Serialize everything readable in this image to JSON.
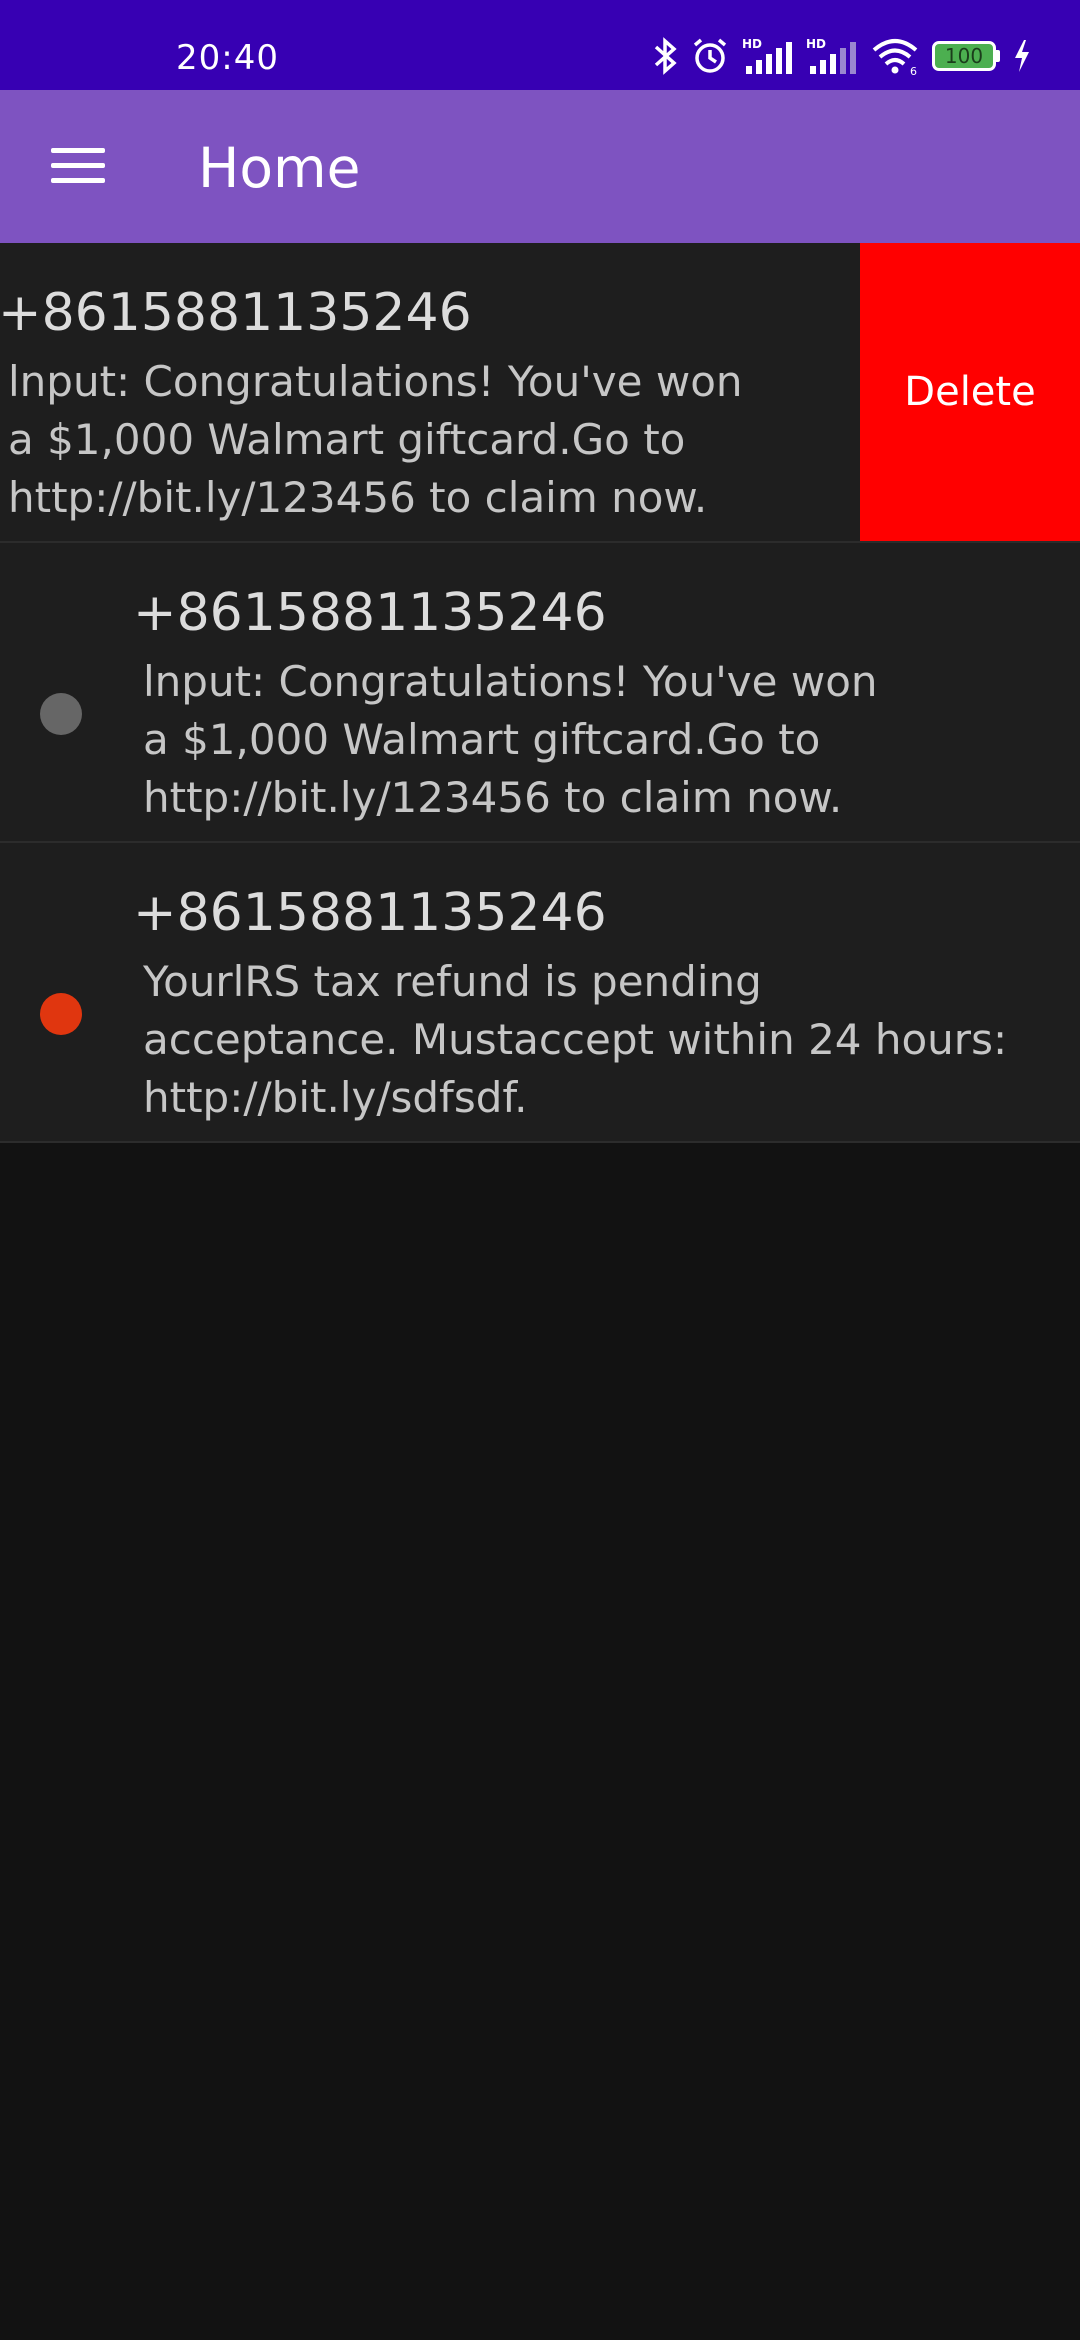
{
  "status_bar": {
    "time": "20:40",
    "battery_level": "100",
    "icons": [
      "bluetooth-icon",
      "alarm-icon",
      "signal-hd-icon",
      "signal-hd-icon",
      "wifi-icon",
      "battery-icon",
      "charging-icon"
    ]
  },
  "app_bar": {
    "title": "Home",
    "menu_icon": "hamburger-menu-icon",
    "background_color": "#7e53c1"
  },
  "messages": [
    {
      "sender": "+8615881135246",
      "preview": "lnput: Congratulations! You've won\na $1,000 Walmart giftcard.Go to\nhttp://bit.ly/123456 to claim now.",
      "status_color": "#666666",
      "swiped": true,
      "delete_label": "Delete"
    },
    {
      "sender": "+8615881135246",
      "preview": "lnput: Congratulations! You've won\na $1,000 Walmart giftcard.Go to\nhttp://bit.ly/123456 to claim now.",
      "status_color": "#666666",
      "swiped": false
    },
    {
      "sender": "+8615881135246",
      "preview": " YourlRS tax refund is pending\nacceptance. Mustaccept within 24 hours:\nhttp://bit.ly/sdfsdf.",
      "status_color": "#e0360f",
      "swiped": false
    }
  ],
  "colors": {
    "status_bar": "#3700b3",
    "delete": "#ff0000",
    "list_background": "#1e1e1e",
    "page_background": "#121212"
  }
}
